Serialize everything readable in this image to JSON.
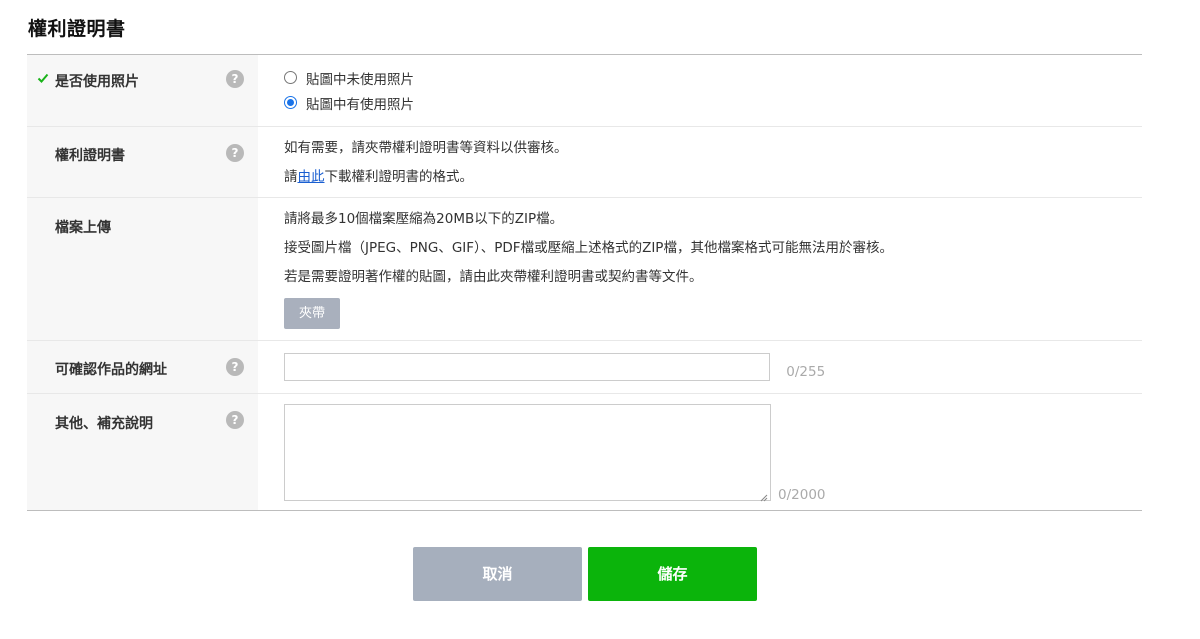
{
  "section": {
    "title": "權利證明書"
  },
  "rows": {
    "photo": {
      "label": "是否使用照片",
      "help": "?",
      "options": [
        {
          "label": "貼圖中未使用照片",
          "checked": false
        },
        {
          "label": "貼圖中有使用照片",
          "checked": true
        }
      ]
    },
    "rights_doc": {
      "label": "權利證明書",
      "help": "?",
      "line1": "如有需要，請夾帶權利證明書等資料以供審核。",
      "line2_prefix": "請",
      "line2_link": "由此",
      "line2_suffix": "下載權利證明書的格式。"
    },
    "upload": {
      "label": "檔案上傳",
      "line1": "請將最多10個檔案壓縮為20MB以下的ZIP檔。",
      "line2": "接受圖片檔（JPEG、PNG、GIF）、PDF檔或壓縮上述格式的ZIP檔，其他檔案格式可能無法用於審核。",
      "line3": "若是需要證明著作權的貼圖，請由此夾帶權利證明書或契約書等文件。",
      "attach_label": "夾帶"
    },
    "url": {
      "label": "可確認作品的網址",
      "help": "?",
      "value": "",
      "counter": "0/255"
    },
    "notes": {
      "label": "其他、補充說明",
      "help": "?",
      "value": "",
      "counter": "0/2000"
    }
  },
  "actions": {
    "cancel_label": "取消",
    "save_label": "儲存"
  },
  "colors": {
    "save": "#0bb40b",
    "cancel": "#a6afbd",
    "attach": "#a9b0bd",
    "link": "#1a5fd1",
    "radio_checked": "#1a73e8",
    "check": "#19b319"
  }
}
